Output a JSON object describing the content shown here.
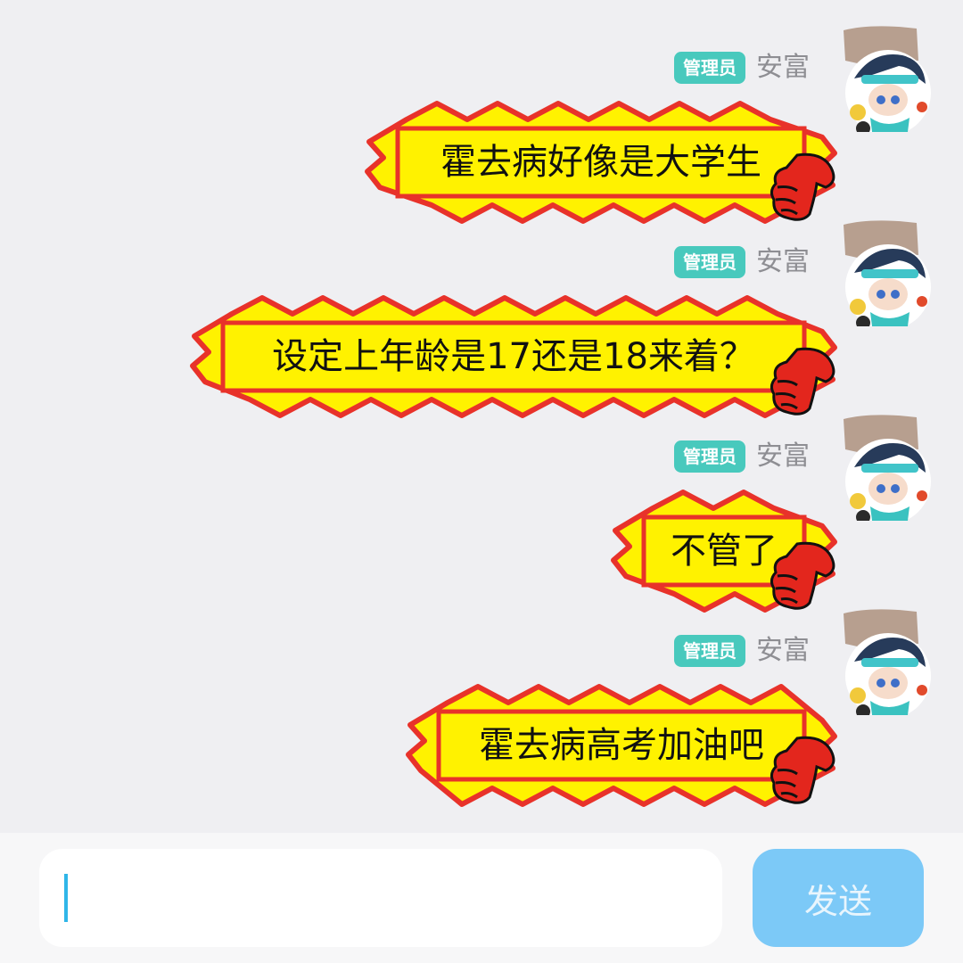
{
  "messages": [
    {
      "role_badge": "管理员",
      "sender": "安富",
      "text": "霍去病好像是大学生"
    },
    {
      "role_badge": "管理员",
      "sender": "安富",
      "text": "设定上年龄是17还是18来着？"
    },
    {
      "role_badge": "管理员",
      "sender": "安富",
      "text": "不管了"
    },
    {
      "role_badge": "管理员",
      "sender": "安富",
      "text": "霍去病高考加油吧"
    }
  ],
  "input": {
    "value": ""
  },
  "send_button": {
    "label": "发送"
  },
  "colors": {
    "background": "#efeff2",
    "badge": "#48c9bd",
    "bubble_fill": "#fff200",
    "bubble_border": "#e8322a",
    "send_button": "#7cc9f7",
    "caret": "#2fb6e8"
  }
}
